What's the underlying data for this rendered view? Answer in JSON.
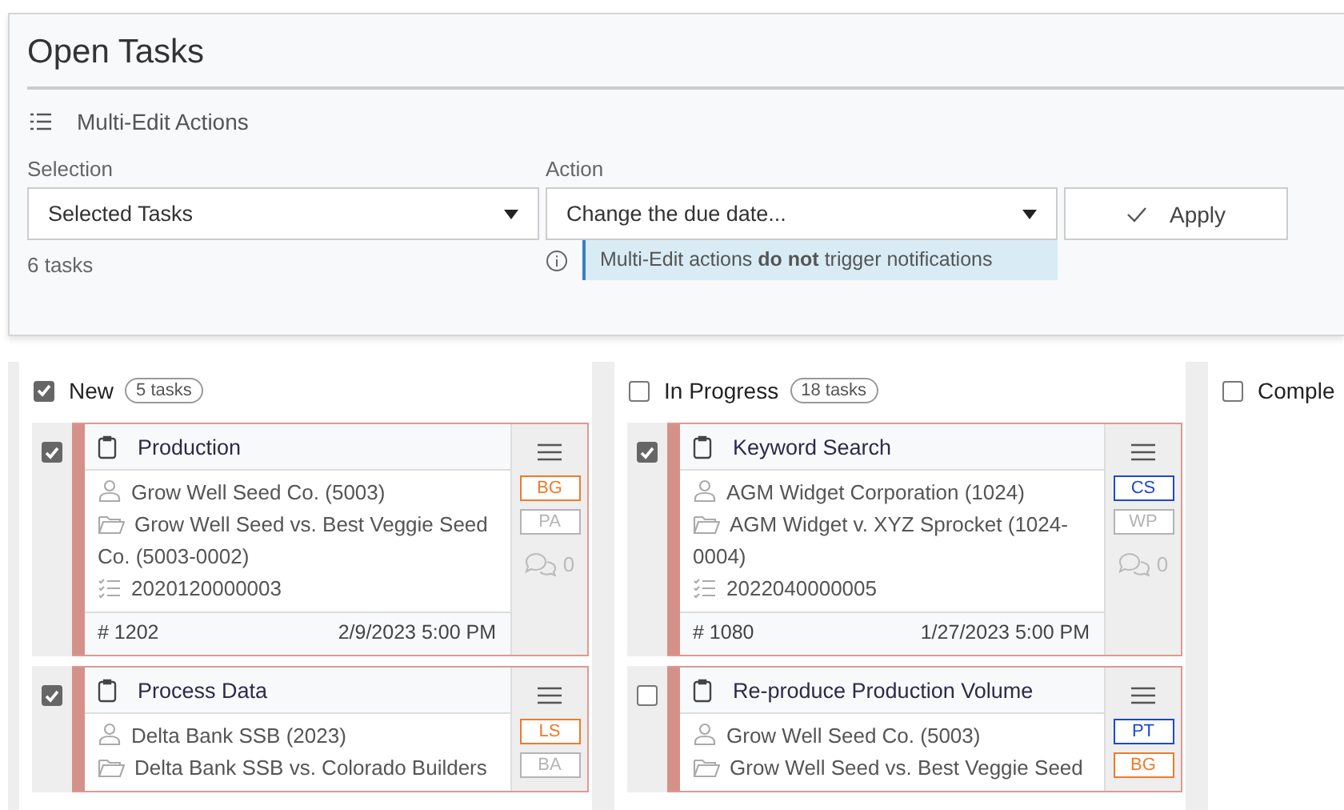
{
  "page": {
    "title": "Open Tasks"
  },
  "multi_edit": {
    "heading": "Multi-Edit Actions",
    "selection": {
      "label": "Selection",
      "value": "Selected Tasks",
      "count": "6 tasks"
    },
    "action": {
      "label": "Action",
      "value": "Change the due date...",
      "note": "Multi-Edit actions **do not** trigger notifications"
    },
    "apply_button": "Apply"
  },
  "columns": [
    {
      "name": "New",
      "checked": true,
      "count": "5 tasks",
      "cards": [
        {
          "checked": true,
          "title": "Production",
          "client": "Grow Well Seed Co. (5003)",
          "matter": "Grow Well Seed vs. Best Veggie Seed Co. (5003-0002)",
          "reference": "2020120000003",
          "number": "# 1202",
          "due": "2/9/2023 5:00 PM",
          "tags": [
            {
              "label": "BG",
              "color": "#f07a2a"
            },
            {
              "label": "PA",
              "color": "#b4b4b4"
            }
          ],
          "comments": "0"
        },
        {
          "checked": true,
          "title": "Process Data",
          "client": "Delta Bank SSB (2023)",
          "matter": "Delta Bank SSB vs. Colorado Builders",
          "tags": [
            {
              "label": "LS",
              "color": "#f07a2a"
            },
            {
              "label": "BA",
              "color": "#b4b4b4"
            }
          ]
        }
      ]
    },
    {
      "name": "In Progress",
      "checked": false,
      "count": "18 tasks",
      "cards": [
        {
          "checked": true,
          "title": "Keyword Search",
          "client": "AGM Widget Corporation (1024)",
          "matter": "AGM Widget v. XYZ Sprocket (1024-0004)",
          "reference": "2022040000005",
          "number": "# 1080",
          "due": "1/27/2023 5:00 PM",
          "tags": [
            {
              "label": "CS",
              "color": "#1c48d0"
            },
            {
              "label": "WP",
              "color": "#b4b4b4"
            }
          ],
          "comments": "0"
        },
        {
          "checked": false,
          "title": "Re-produce Production Volume",
          "client": "Grow Well Seed Co. (5003)",
          "matter": "Grow Well Seed vs. Best Veggie Seed",
          "tags": [
            {
              "label": "PT",
              "color": "#1c48d0"
            },
            {
              "label": "BG",
              "color": "#f07a2a"
            }
          ]
        }
      ]
    },
    {
      "name": "Comple",
      "checked": false
    }
  ]
}
